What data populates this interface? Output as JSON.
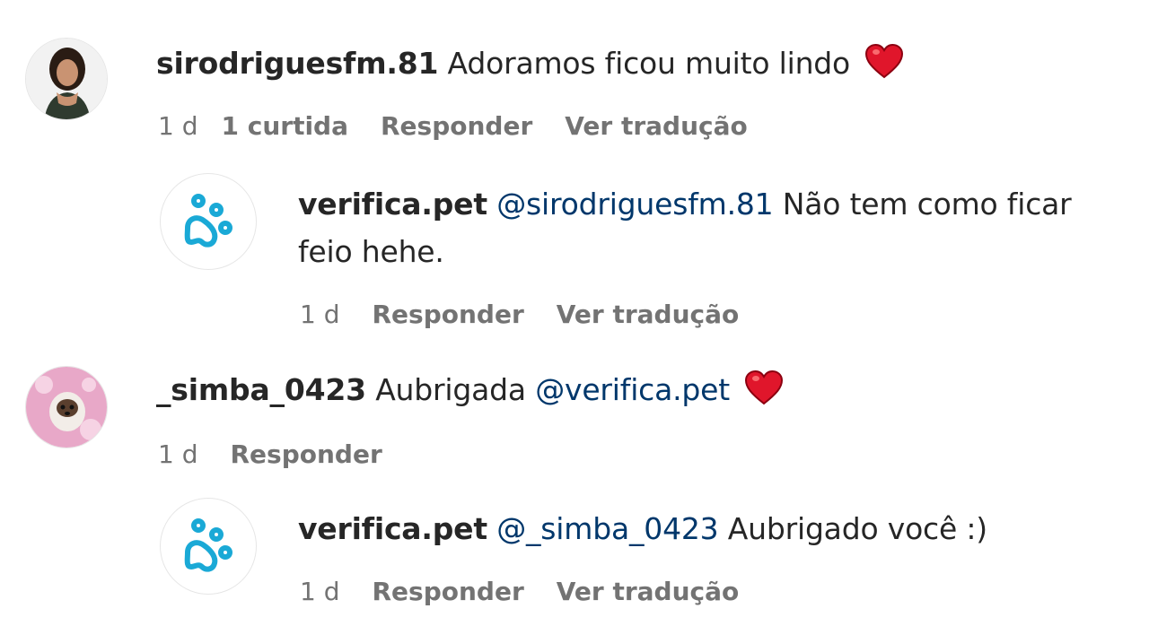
{
  "comments": [
    {
      "username": "sirodriguesfm.81",
      "text": "Adoramos ficou muito lindo",
      "emoji": "heart",
      "time": "1 d",
      "likes": "1 curtida",
      "reply_label": "Responder",
      "translate_label": "Ver tradução"
    },
    {
      "username": "verifica.pet",
      "mention": "@sirodriguesfm.81",
      "text_line1": "Não tem como ficar",
      "text_line2": "feio hehe.",
      "time": "1 d",
      "reply_label": "Responder",
      "translate_label": "Ver tradução"
    },
    {
      "username": "_simba_0423",
      "text": "Aubrigada",
      "mention": "@verifica.pet",
      "emoji": "heart",
      "time": "1 d",
      "reply_label": "Responder"
    },
    {
      "username": "verifica.pet",
      "mention": "@_simba_0423",
      "text": "Aubrigado você :)",
      "time": "1 d",
      "reply_label": "Responder",
      "translate_label": "Ver tradução"
    }
  ],
  "colors": {
    "mention": "#00376b",
    "meta": "#737373",
    "paw": "#1aa9d6",
    "heart": "#e0162b"
  },
  "icons": {
    "paw": "paw-icon",
    "heart": "heart-icon"
  }
}
